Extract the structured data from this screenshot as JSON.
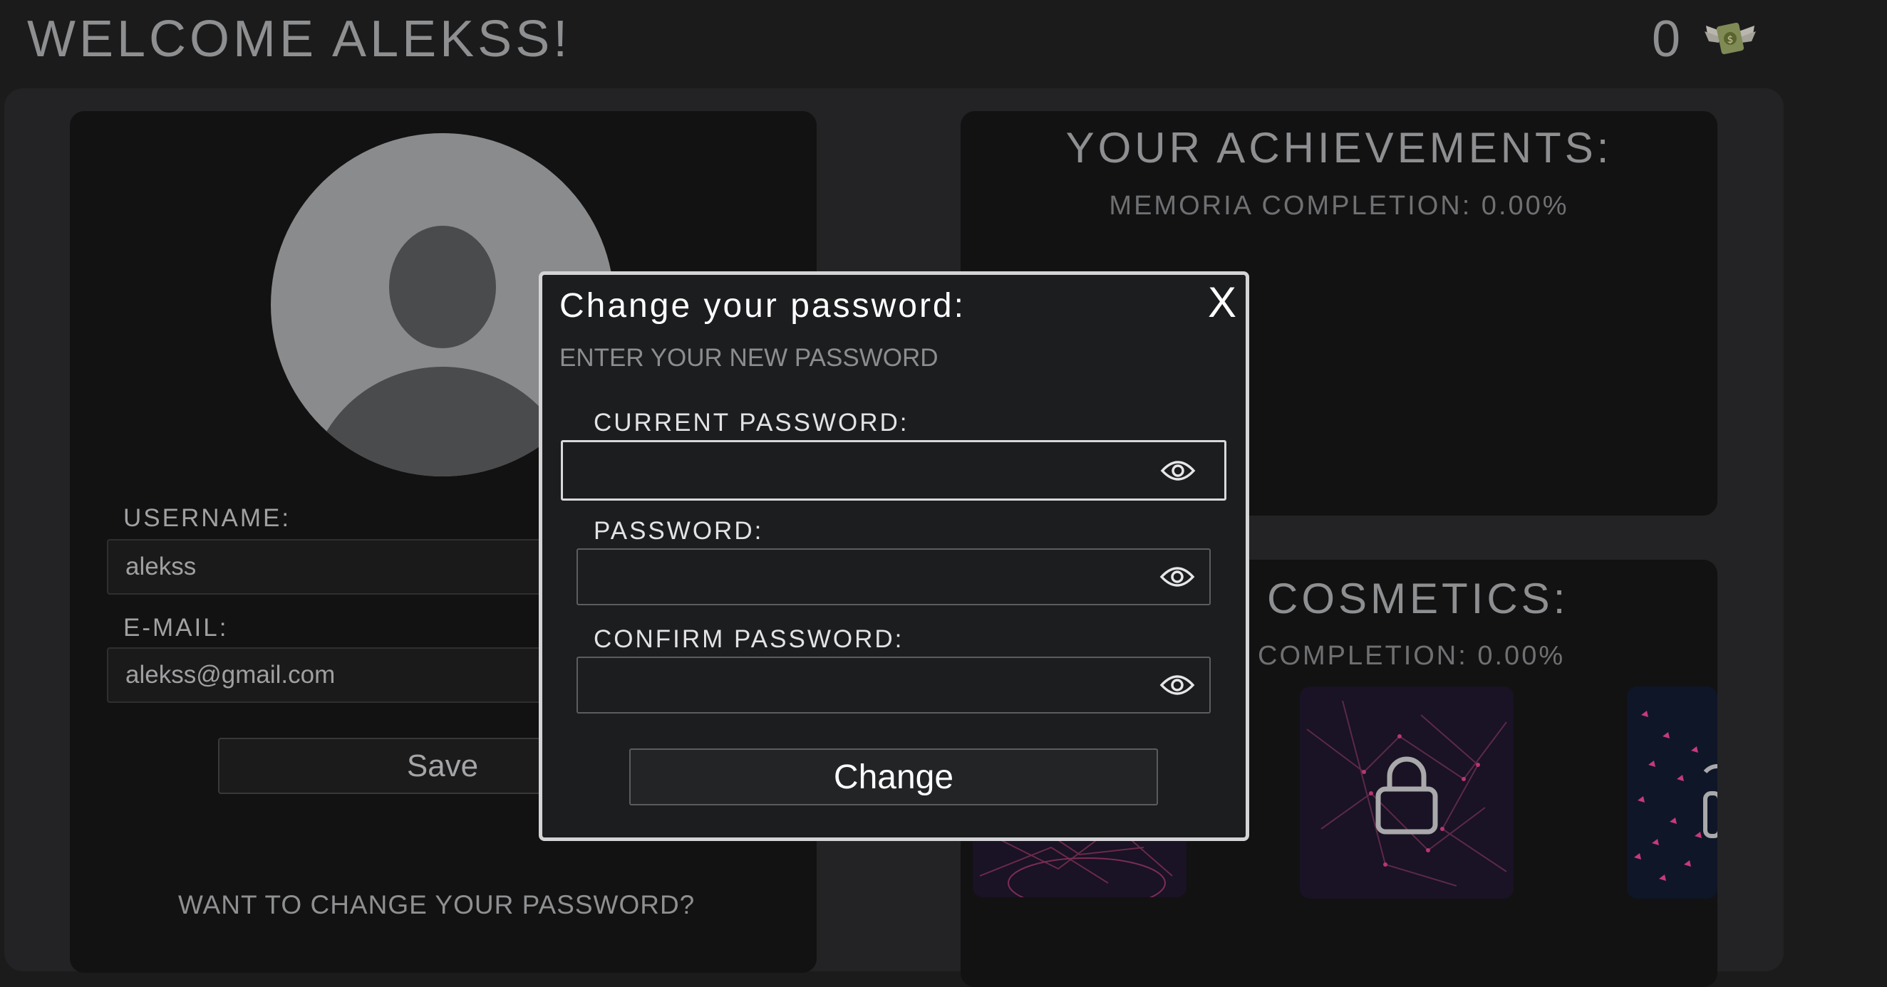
{
  "header": {
    "welcome_text": "WELCOME ALEKSS!",
    "coin_count": "0",
    "coin_icon": "flying-money-icon"
  },
  "profile": {
    "avatar_icon": "user-avatar-icon",
    "username_label": "USERNAME:",
    "username_value": "alekss",
    "email_label": "E-MAIL:",
    "email_value": "alekss@gmail.com",
    "save_label": "Save",
    "change_password_link": "WANT TO CHANGE YOUR PASSWORD?"
  },
  "achievements": {
    "title": "YOUR ACHIEVEMENTS:",
    "completion": "MEMORIA COMPLETION: 0.00%"
  },
  "cosmetics": {
    "title": "COSMETICS:",
    "completion": "COMPLETION: 0.00%",
    "lock_icon": "lock-icon"
  },
  "modal": {
    "title": "Change your password:",
    "close_label": "X",
    "subtitle": "ENTER YOUR NEW PASSWORD",
    "current_password_label": "CURRENT PASSWORD:",
    "password_label": "PASSWORD:",
    "confirm_password_label": "CONFIRM PASSWORD:",
    "eye_icon": "eye-icon",
    "change_label": "Change"
  },
  "colors": {
    "background": "#1b1b1c",
    "panel": "#121213",
    "modal_border": "#d4d4d6",
    "text_muted": "#8e8f91",
    "avatar": "#8a8b8d"
  }
}
